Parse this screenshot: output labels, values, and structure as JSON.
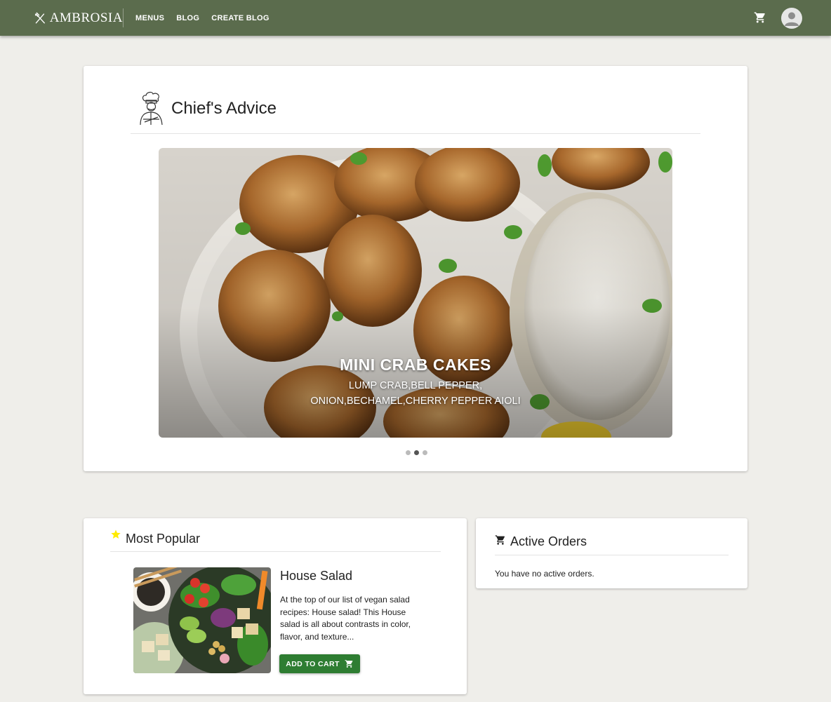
{
  "app": {
    "brand": "AMBROSIA",
    "nav": [
      "MENUS",
      "BLOG",
      "CREATE BLOG"
    ],
    "colors": {
      "topbar": "#5b6c4d",
      "accent_button": "#2e7d32",
      "star": "#ffeb00"
    }
  },
  "chief": {
    "title": "Chief's Advice",
    "slide": {
      "title": "MINI CRAB CAKES",
      "description_line1": "LUMP CRAB,BELL PEPPER,",
      "description_line2": "ONION,BECHAMEL,CHERRY PEPPER AIOLI"
    },
    "slide_count": 3,
    "active_slide": 2
  },
  "popular": {
    "title": "Most Popular",
    "item": {
      "name": "House Salad",
      "description": "At the top of our list of vegan salad recipes: House salad! This House salad is all about contrasts in color, flavor, and texture...",
      "button_label": "ADD TO CART"
    }
  },
  "orders": {
    "title": "Active Orders",
    "empty_message": "You have no active orders."
  },
  "icons": [
    "fork-knife-logo-icon",
    "cart-icon",
    "account-icon",
    "chef-icon",
    "star-icon"
  ]
}
